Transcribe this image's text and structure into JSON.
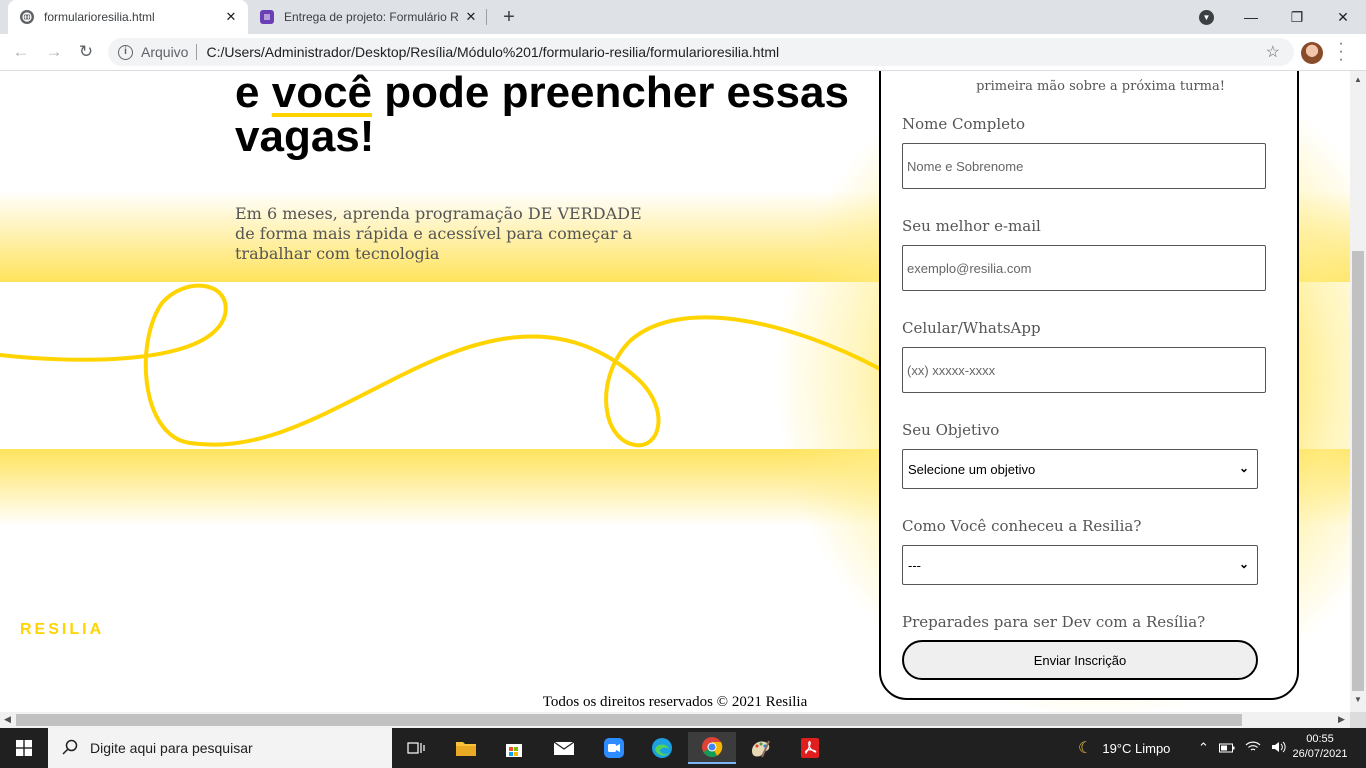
{
  "browser": {
    "tabs": [
      {
        "title": "formularioresilia.html",
        "close": "✕"
      },
      {
        "title": "Entrega de projeto: Formulário R",
        "close": "✕"
      }
    ],
    "new_tab": "+",
    "window_controls": {
      "minimize": "—",
      "maximize": "❐",
      "close": "✕"
    },
    "nav": {
      "back": "←",
      "forward": "→",
      "reload": "↻"
    },
    "address": {
      "security": "Arquivo",
      "url": "C:/Users/Administrador/Desktop/Resília/Módulo%201/formulario-resilia/formularioresilia.html",
      "bookmark": "☆"
    }
  },
  "page": {
    "heading_prefix": "e",
    "heading_underlined": "você",
    "heading_rest": "pode preencher essas vagas!",
    "lead": "Em 6 meses, aprenda programação DE VERDADE de forma mais rápida e acessível para começar a trabalhar com tecnologia",
    "logo": "RESILIA",
    "footer": "Todos os direitos reservados © 2021 Resilia",
    "colors": {
      "accent": "#ffd400",
      "band": "#ffe35c"
    },
    "form": {
      "intro_tail": "primeira mão sobre a próxima turma!",
      "name_label": "Nome Completo",
      "name_placeholder": "Nome e Sobrenome",
      "email_label": "Seu melhor e-mail",
      "email_placeholder": "exemplo@resilia.com",
      "phone_label": "Celular/WhatsApp",
      "phone_placeholder": "(xx) xxxxx-xxxx",
      "objective_label": "Seu Objetivo",
      "objective_selected": "Selecione um objetivo",
      "source_label": "Como Você conheceu a Resilia?",
      "source_selected": "---",
      "ready_label": "Preparades para ser Dev com a Resília?",
      "submit": "Enviar Inscrição"
    }
  },
  "taskbar": {
    "search_placeholder": "Digite aqui para pesquisar",
    "weather": "19°C  Limpo",
    "time": "00:55",
    "date": "26/07/2021"
  }
}
